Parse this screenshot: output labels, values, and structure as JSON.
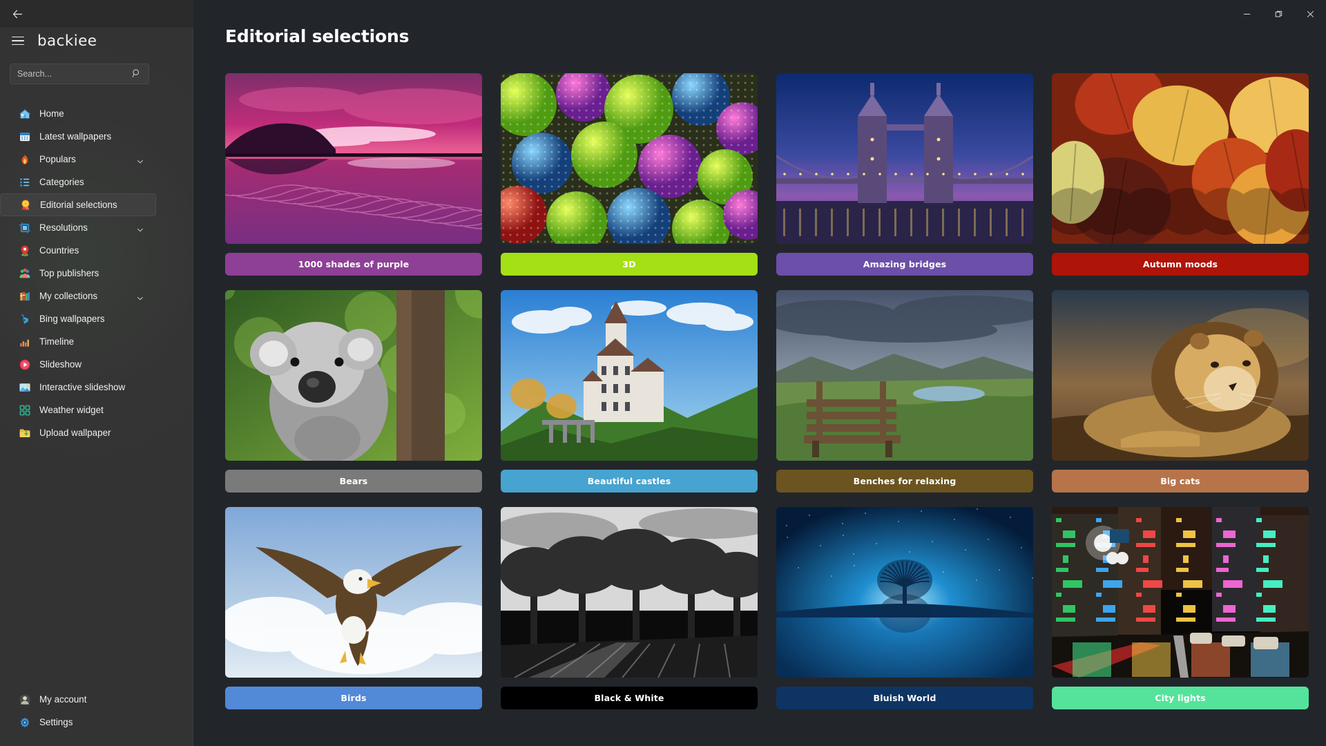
{
  "window": {
    "controls": [
      {
        "name": "minimize",
        "glyph": "minimize-icon"
      },
      {
        "name": "restore",
        "glyph": "restore-icon"
      },
      {
        "name": "close",
        "glyph": "close-icon"
      }
    ]
  },
  "sidebar": {
    "back_icon": "back-arrow-icon",
    "menu_icon": "hamburger-icon",
    "brand": "backiee",
    "search": {
      "value": "",
      "placeholder": "Search...",
      "icon": "search-icon"
    },
    "items": [
      {
        "label": "Home",
        "icon": "home-icon",
        "expandable": false,
        "selected": false
      },
      {
        "label": "Latest wallpapers",
        "icon": "calendar-icon",
        "expandable": false,
        "selected": false
      },
      {
        "label": "Populars",
        "icon": "flame-icon",
        "expandable": true,
        "selected": false
      },
      {
        "label": "Categories",
        "icon": "list-icon",
        "expandable": false,
        "selected": false
      },
      {
        "label": "Editorial selections",
        "icon": "rosette-icon",
        "expandable": false,
        "selected": true
      },
      {
        "label": "Resolutions",
        "icon": "crop-icon",
        "expandable": true,
        "selected": false
      },
      {
        "label": "Countries",
        "icon": "map-pin-icon",
        "expandable": false,
        "selected": false
      },
      {
        "label": "Top publishers",
        "icon": "people-icon",
        "expandable": false,
        "selected": false
      },
      {
        "label": "My collections",
        "icon": "books-icon",
        "expandable": true,
        "selected": false
      },
      {
        "label": "Bing wallpapers",
        "icon": "bing-icon",
        "expandable": false,
        "selected": false
      },
      {
        "label": "Timeline",
        "icon": "chart-icon",
        "expandable": false,
        "selected": false
      },
      {
        "label": "Slideshow",
        "icon": "play-circle-icon",
        "expandable": false,
        "selected": false
      },
      {
        "label": "Interactive slideshow",
        "icon": "landscape-icon",
        "expandable": false,
        "selected": false
      },
      {
        "label": "Weather widget",
        "icon": "grid-squares-icon",
        "expandable": false,
        "selected": false
      },
      {
        "label": "Upload wallpaper",
        "icon": "upload-folder-icon",
        "expandable": false,
        "selected": false
      }
    ],
    "footer_items": [
      {
        "label": "My account",
        "icon": "user-avatar-icon"
      },
      {
        "label": "Settings",
        "icon": "gear-icon"
      }
    ],
    "accent_color": "#4cc2ff",
    "background_color": "#333333"
  },
  "main": {
    "title": "Editorial selections",
    "background_color": "#22262b",
    "cards": [
      {
        "label": "1000 shades of purple",
        "color": "#8e3f96",
        "thumb": "purple-sunset-lake"
      },
      {
        "label": "3D",
        "color": "#a3e015",
        "thumb": "green-3d-spheres"
      },
      {
        "label": "Amazing bridges",
        "color": "#6b4fa8",
        "thumb": "tower-bridge-night"
      },
      {
        "label": "Autumn moods",
        "color": "#ae1408",
        "thumb": "autumn-leaves"
      },
      {
        "label": "Bears",
        "color": "#7a7a7a",
        "thumb": "koala-on-tree"
      },
      {
        "label": "Beautiful castles",
        "color": "#47a3cf",
        "thumb": "lichtenstein-castle"
      },
      {
        "label": "Benches for relaxing",
        "color": "#6b5420",
        "thumb": "bench-green-valley"
      },
      {
        "label": "Big cats",
        "color": "#b7744a",
        "thumb": "lion-resting"
      },
      {
        "label": "Birds",
        "color": "#5289d8",
        "thumb": "eagle-in-flight"
      },
      {
        "label": "Black & White",
        "color": "#000000",
        "thumb": "bw-trees-road"
      },
      {
        "label": "Bluish World",
        "color": "#0e3463",
        "thumb": "blue-lone-tree"
      },
      {
        "label": "City lights",
        "color": "#55e39b",
        "thumb": "neon-city-street"
      }
    ]
  }
}
